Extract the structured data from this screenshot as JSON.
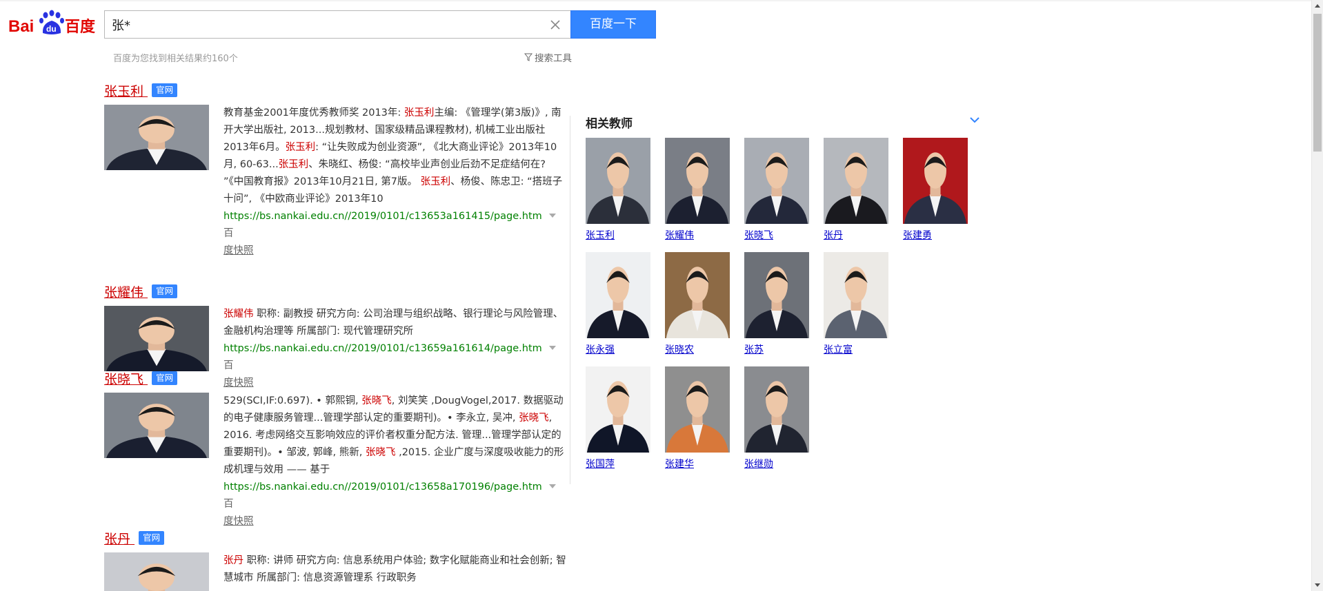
{
  "header": {
    "logo_text_left": "Bai",
    "logo_text_paw": "du",
    "logo_text_right": "百度",
    "search_value": "张*",
    "search_button": "百度一下",
    "result_count": "百度为您找到相关结果约160个",
    "search_tools": "搜索工具"
  },
  "results": [
    {
      "title": "张玉利",
      "badge": "官网",
      "segments": [
        {
          "t": "教育基金2001年度优秀教师奖 2013年: "
        },
        {
          "t": "张玉利",
          "hl": true
        },
        {
          "t": "主编: 《管理学(第3版)》, 南开大学出版社, 2013...规划教材、国家级精品课程教材), 机械工业出版社2013年6月。"
        },
        {
          "t": "张玉利",
          "hl": true
        },
        {
          "t": ": “让失败成为创业资源”, 《北大商业评论》2013年10月, 60-63..."
        },
        {
          "t": "张玉利",
          "hl": true
        },
        {
          "t": "、朱晓红、杨俊: “高校毕业声创业后劲不足症结何在? ”《中国教育报》2013年10月21日, 第7版。 "
        },
        {
          "t": "张玉利",
          "hl": true
        },
        {
          "t": "、杨俊、陈忠卫: “搭班子十问”, 《中欧商业评论》2013年10"
        }
      ],
      "url": "https://bs.nankai.edu.cn//2019/0101/c13653a161415/page.htm",
      "snapshot_prefix": "百",
      "snapshot": "度快照"
    },
    {
      "title": "张耀伟",
      "badge": "官网",
      "segments": [
        {
          "t": "张耀伟",
          "hl": true
        },
        {
          "t": " 职称: 副教授 研究方向: 公司治理与组织战略、银行理论与风险管理、金融机构治理等 所属部门: 现代管理研究所"
        }
      ],
      "url": "https://bs.nankai.edu.cn//2019/0101/c13659a161614/page.htm",
      "snapshot_prefix": "百",
      "snapshot": "度快照"
    },
    {
      "title": "张晓飞",
      "badge": "官网",
      "segments": [
        {
          "t": "529(SCI,IF:0.697). • 郭熙铜, "
        },
        {
          "t": "张晓飞",
          "hl": true
        },
        {
          "t": ", 刘笑笑 ,DougVogel,2017. 数据驱动的电子健康服务管理...管理学部认定的重要期刊)。• 李永立, 吴冲, "
        },
        {
          "t": "张晓飞",
          "hl": true
        },
        {
          "t": ", 2016. 考虑网络交互影响效应的评价者权重分配方法. 管理...管理学部认定的重要期刊)。• 邹波, 郭峰, 熊新, "
        },
        {
          "t": "张晓飞",
          "hl": true
        },
        {
          "t": " ,2015. 企业广度与深度吸收能力的形成机理与效用 —— 基于"
        }
      ],
      "url": "https://bs.nankai.edu.cn//2019/0101/c13658a170196/page.htm",
      "snapshot_prefix": "百",
      "snapshot": "度快照"
    },
    {
      "title": "张丹",
      "badge": "官网",
      "segments": [
        {
          "t": "张丹",
          "hl": true
        },
        {
          "t": " 职称: 讲师 研究方向: 信息系统用户体验; 数字化赋能商业和社会创新; 智慧城市 所属部门: 信息资源管理系 行政职务"
        }
      ],
      "url": "",
      "snapshot_prefix": "",
      "snapshot": ""
    }
  ],
  "panel": {
    "title": "相关教师",
    "teachers": [
      {
        "name": "张玉利",
        "bg": "#9aa0a8",
        "suit": "#2b2f3a"
      },
      {
        "name": "张耀伟",
        "bg": "#7a7e86",
        "suit": "#1c2030"
      },
      {
        "name": "张晓飞",
        "bg": "#a9adb4",
        "suit": "#23283a"
      },
      {
        "name": "张丹",
        "bg": "#b5b8bd",
        "suit": "#1a1a1f"
      },
      {
        "name": "张建勇",
        "bg": "#b0181c",
        "suit": "#2a2f44"
      },
      {
        "name": "张永强",
        "bg": "#eef0f2",
        "suit": "#161a2a"
      },
      {
        "name": "张晓农",
        "bg": "#8d6a45",
        "suit": "#e8e4dc"
      },
      {
        "name": "张苏",
        "bg": "#6d7178",
        "suit": "#1d2130"
      },
      {
        "name": "张立富",
        "bg": "#eceae6",
        "suit": "#5b6270"
      },
      {
        "name": "张国萍",
        "bg": "#f2f2f2",
        "suit": "#101628"
      },
      {
        "name": "张建华",
        "bg": "#8f8f8f",
        "suit": "#d8783a"
      },
      {
        "name": "张继勋",
        "bg": "#8a8c90",
        "suit": "#202430"
      }
    ]
  }
}
